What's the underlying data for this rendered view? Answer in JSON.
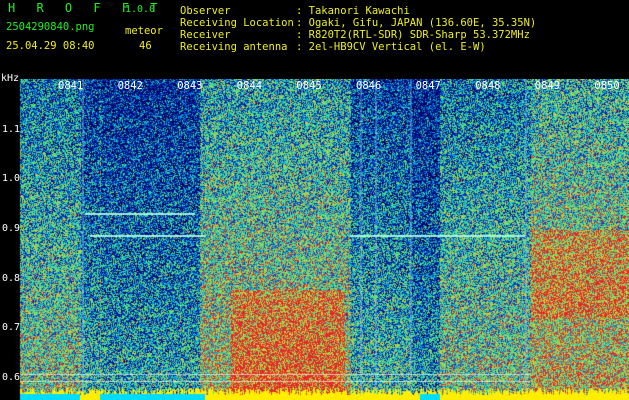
{
  "app": {
    "title": "H R O F F T",
    "version": "1.0.0",
    "filename": "2504290840.png",
    "datetime": "25.04.29 08:40",
    "meteor_label": "meteor",
    "meteor_count": "46"
  },
  "info": {
    "observer_label": "Observer",
    "observer_value": ": Takanori Kawachi",
    "location_label": "Receiving Location",
    "location_value": ": Ogaki, Gifu, JAPAN (136.60E, 35.35N)",
    "receiver_label": "Receiver",
    "receiver_value": ": R820T2(RTL-SDR) SDR-Sharp 53.372MHz",
    "antenna_label": "Receiving antenna",
    "antenna_value": ": 2el-HB9CV Vertical (el. E-W)"
  },
  "spectrogram": {
    "y_unit": "kHz",
    "y_ticks": [
      "1.1",
      "1.0",
      "0.9",
      "0.8",
      "0.7",
      "0.6"
    ],
    "x_ticks": [
      "0841",
      "0842",
      "0843",
      "0844",
      "0845",
      "0846",
      "0847",
      "0848",
      "0849",
      "0850"
    ],
    "colors": {
      "background": "#000066",
      "noise_low": "#0033cc",
      "noise_mid": "#00ccdd",
      "noise_high": "#55ee88",
      "peak": "#ee2222",
      "baseline": "#ffee00"
    }
  }
}
